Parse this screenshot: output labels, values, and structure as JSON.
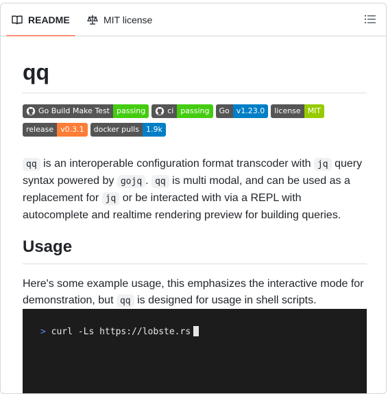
{
  "tabs": [
    {
      "label": "README",
      "icon": "book-icon",
      "active": true
    },
    {
      "label": "MIT license",
      "icon": "law-icon",
      "active": false
    }
  ],
  "outline_icon": "list-unordered-icon",
  "title": "qq",
  "badges": [
    [
      {
        "left": "Go Build Make Test",
        "right": "passing",
        "color": "#4c1",
        "logo": "github-icon"
      },
      {
        "left": "ci",
        "right": "passing",
        "color": "#4c1",
        "logo": "github-icon"
      },
      {
        "left": "Go",
        "right": "v1.23.0",
        "color": "#007ec6"
      },
      {
        "left": "license",
        "right": "MIT",
        "color": "#97ca00"
      }
    ],
    [
      {
        "left": "release",
        "right": "v0.3.1",
        "color": "#fe7d37"
      },
      {
        "left": "docker pulls",
        "right": "1.9k",
        "color": "#007ec6"
      }
    ]
  ],
  "intro": {
    "c1": "qq",
    "t1": " is an interoperable configuration format transcoder with ",
    "c2": "jq",
    "t2": " query syntax powered by ",
    "c3": "gojq",
    "t3": ". ",
    "c4": "qq",
    "t4": " is multi modal, and can be used as a replacement for ",
    "c5": "jq",
    "t5": " or be interacted with via a REPL with autocomplete and realtime rendering preview for building queries."
  },
  "usage_heading": "Usage",
  "usage": {
    "t1": "Here's some example usage, this emphasizes the interactive mode for demonstration, but ",
    "c1": "qq",
    "t2": " is designed for usage in shell scripts."
  },
  "terminal": {
    "prompt": ">",
    "command": "curl -Ls https://lobste.rs"
  },
  "colors": {
    "tab_underline": "#fd8c73",
    "badge_left": "#555555",
    "terminal_bg": "#1c1c1c",
    "prompt": "#5f87ff"
  }
}
